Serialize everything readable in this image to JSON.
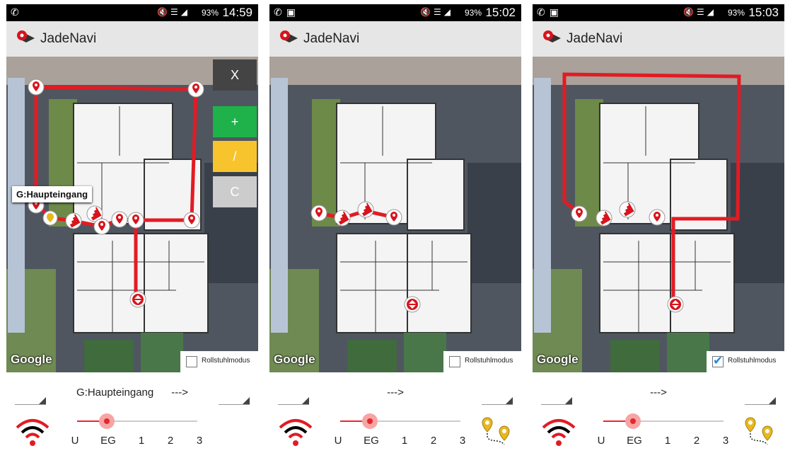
{
  "app": {
    "title": "JadeNavi"
  },
  "screens": [
    {
      "clock": "14:59",
      "battery": "93%",
      "tooltip": "G:Haupteingang",
      "buttons": {
        "close": "X",
        "add": "+",
        "edit": "/",
        "clear": "C"
      },
      "map_label": "Google",
      "wheelchair": {
        "label": "Rollstuhlmodus",
        "checked": false
      },
      "route": {
        "from": "G:Haupteingang",
        "arrow": "--->"
      },
      "floors": [
        "U",
        "EG",
        "1",
        "2",
        "3"
      ],
      "selected_floor": "EG"
    },
    {
      "clock": "15:02",
      "battery": "93%",
      "map_label": "Google",
      "wheelchair": {
        "label": "Rollstuhlmodus",
        "checked": false
      },
      "route": {
        "from": "",
        "arrow": "--->"
      },
      "floors": [
        "U",
        "EG",
        "1",
        "2",
        "3"
      ],
      "selected_floor": "EG"
    },
    {
      "clock": "15:03",
      "battery": "93%",
      "map_label": "Google",
      "wheelchair": {
        "label": "Rollstuhlmodus",
        "checked": true
      },
      "route": {
        "from": "",
        "arrow": "--->"
      },
      "floors": [
        "U",
        "EG",
        "1",
        "2",
        "3"
      ],
      "selected_floor": "EG"
    }
  ],
  "colors": {
    "route": "#e21b23",
    "add": "#1fb24a",
    "edit": "#f7c42e",
    "close": "#444444",
    "clear": "#cccccc"
  },
  "icons": [
    "whatsapp-icon",
    "image-icon",
    "mute-icon",
    "wifi-icon",
    "signal-icon",
    "battery-icon",
    "jadenavi-logo-icon",
    "map-marker-icon",
    "stairs-icon",
    "elevator-icon",
    "route-icon"
  ]
}
